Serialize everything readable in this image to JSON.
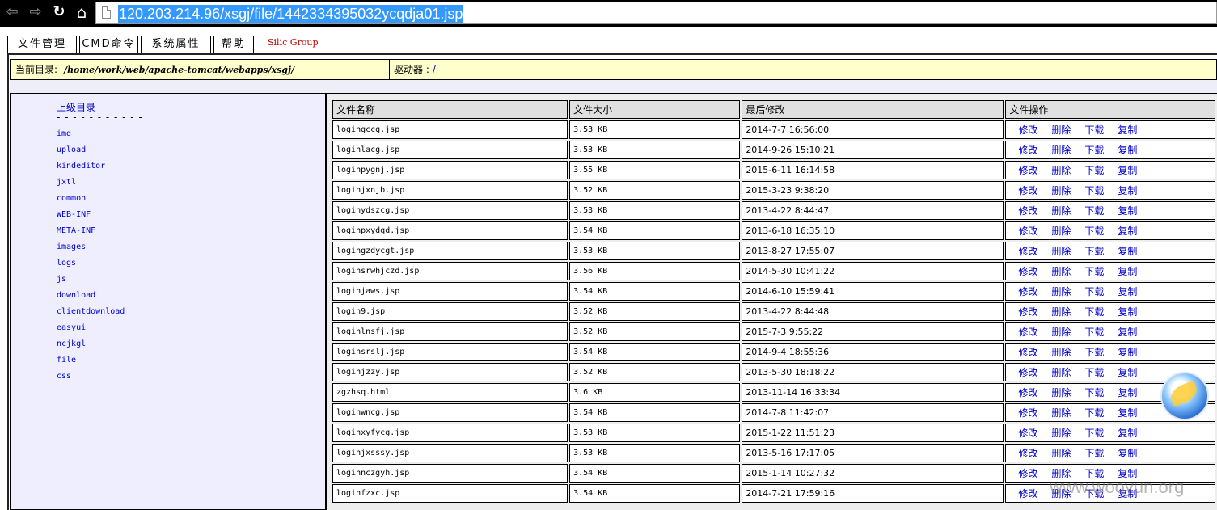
{
  "browser": {
    "url": "120.203.214.96/xsgj/file/1442334395032ycqdja01.jsp",
    "back_glyph": "⇦",
    "forward_glyph": "⇨",
    "reload_glyph": "↻",
    "home_glyph": "⌂"
  },
  "menu": {
    "items": [
      "文件管理",
      "CMD命令",
      "系统属性",
      "帮助"
    ],
    "brand": "Silic Group"
  },
  "info": {
    "current_dir_label": "当前目录:",
    "current_dir": "/home/work/web/apache-tomcat/webapps/xsgj/",
    "drive_label": "驱动器 :",
    "drive": "/"
  },
  "dirs": {
    "up_label": "上级目录",
    "separator": "- - - - - - - - - - -",
    "items": [
      "img",
      "upload",
      "kindeditor",
      "jxtl",
      "common",
      "WEB-INF",
      "META-INF",
      "images",
      "logs",
      "js",
      "download",
      "clientdownload",
      "easyui",
      "ncjkgl",
      "file",
      "css"
    ]
  },
  "table": {
    "headers": [
      "文件名称",
      "文件大小",
      "最后修改",
      "文件操作"
    ],
    "ops": [
      "修改",
      "删除",
      "下载",
      "复制"
    ],
    "rows": [
      {
        "name": "logingccg.jsp",
        "size": "3.53 KB",
        "modified": "2014-7-7 16:56:00"
      },
      {
        "name": "loginlacg.jsp",
        "size": "3.53 KB",
        "modified": "2014-9-26 15:10:21"
      },
      {
        "name": "loginpygnj.jsp",
        "size": "3.55 KB",
        "modified": "2015-6-11 16:14:58"
      },
      {
        "name": "loginjxnjb.jsp",
        "size": "3.52 KB",
        "modified": "2015-3-23 9:38:20"
      },
      {
        "name": "loginydszcg.jsp",
        "size": "3.53 KB",
        "modified": "2013-4-22 8:44:47"
      },
      {
        "name": "loginpxydqd.jsp",
        "size": "3.54 KB",
        "modified": "2013-6-18 16:35:10"
      },
      {
        "name": "logingzdycgt.jsp",
        "size": "3.53 KB",
        "modified": "2013-8-27 17:55:07"
      },
      {
        "name": "loginsrwhjczd.jsp",
        "size": "3.56 KB",
        "modified": "2014-5-30 10:41:22"
      },
      {
        "name": "loginjaws.jsp",
        "size": "3.54 KB",
        "modified": "2014-6-10 15:59:41"
      },
      {
        "name": "login9.jsp",
        "size": "3.52 KB",
        "modified": "2013-4-22 8:44:48"
      },
      {
        "name": "loginlnsfj.jsp",
        "size": "3.52 KB",
        "modified": "2015-7-3 9:55:22"
      },
      {
        "name": "loginsrslj.jsp",
        "size": "3.54 KB",
        "modified": "2014-9-4 18:55:36"
      },
      {
        "name": "loginjzzy.jsp",
        "size": "3.52 KB",
        "modified": "2013-5-30 18:18:22"
      },
      {
        "name": "zgzhsq.html",
        "size": "3.6 KB",
        "modified": "2013-11-14 16:33:34"
      },
      {
        "name": "loginwncg.jsp",
        "size": "3.54 KB",
        "modified": "2014-7-8 11:42:07"
      },
      {
        "name": "loginxyfycg.jsp",
        "size": "3.53 KB",
        "modified": "2015-1-22 11:51:23"
      },
      {
        "name": "loginjxsssy.jsp",
        "size": "3.53 KB",
        "modified": "2013-5-16 17:17:05"
      },
      {
        "name": "loginnczgyh.jsp",
        "size": "3.54 KB",
        "modified": "2015-1-14 10:27:32"
      },
      {
        "name": "loginfzxc.jsp",
        "size": "3.54 KB",
        "modified": "2014-7-21 17:59:16"
      }
    ]
  },
  "watermark": "www.wooyun.org"
}
